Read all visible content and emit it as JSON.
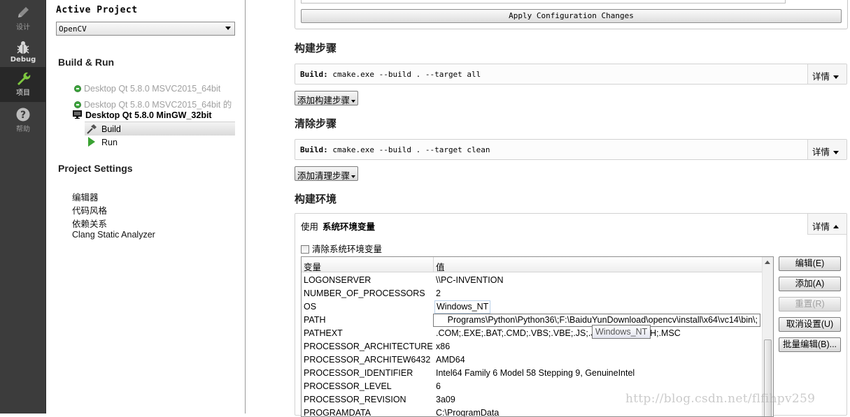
{
  "modebar": {
    "items": [
      {
        "label": "设计",
        "icon": "pencil-icon"
      },
      {
        "label": "Debug",
        "icon": "bug-icon"
      },
      {
        "label": "项目",
        "icon": "wrench-icon"
      },
      {
        "label": "帮助",
        "icon": "help-icon"
      }
    ]
  },
  "nav": {
    "active_project_title": "Active Project",
    "project_select_value": "OpenCV",
    "build_run_title": "Build & Run",
    "kits": [
      "Desktop Qt 5.8.0 MSVC2015_64bit",
      "Desktop Qt 5.8.0 MSVC2015_64bit 的",
      "Desktop Qt 5.8.0 MinGW_32bit"
    ],
    "build_label": "Build",
    "run_label": "Run",
    "project_settings_title": "Project Settings",
    "settings_items": [
      "编辑器",
      "代码风格",
      "依赖关系",
      "Clang Static Analyzer"
    ]
  },
  "main": {
    "apply_button": "Apply Configuration Changes",
    "build_steps_heading": "构建步骤",
    "build_step_prefix": "Build:",
    "build_step_command": "cmake.exe --build . --target all",
    "details_label": "详情",
    "add_build_step": "添加构建步骤",
    "clean_steps_heading": "清除步骤",
    "clean_step_prefix": "Build:",
    "clean_step_command": "cmake.exe --build . --target clean",
    "add_clean_step": "添加清理步骤",
    "build_env_heading": "构建环境",
    "env_use_label": "使用",
    "env_use_value": "系统环境变量",
    "clear_system_env": "清除系统环境变量",
    "table_headers": [
      "变量",
      "值"
    ],
    "env_rows": [
      {
        "name": "LOGONSERVER",
        "value": "\\\\PC-INVENTION"
      },
      {
        "name": "NUMBER_OF_PROCESSORS",
        "value": "2"
      },
      {
        "name": "OS",
        "value": "Windows_NT"
      },
      {
        "name": "PATH",
        "value": "Programs\\Python\\Python36\\;F:\\BaiduYunDownload\\opencv\\install\\x64\\vc14\\bin\\;"
      },
      {
        "name": "PATHEXT",
        "value": ".COM;.EXE;.BAT;.CMD;.VBS;.VBE;.JS;.JSE;.WSF;.WSH;.MSC"
      },
      {
        "name": "PROCESSOR_ARCHITECTURE",
        "value": "x86"
      },
      {
        "name": "PROCESSOR_ARCHITEW6432",
        "value": "AMD64"
      },
      {
        "name": "PROCESSOR_IDENTIFIER",
        "value": "Intel64 Family 6 Model 58 Stepping 9, GenuineIntel"
      },
      {
        "name": "PROCESSOR_LEVEL",
        "value": "6"
      },
      {
        "name": "PROCESSOR_REVISION",
        "value": "3a09"
      },
      {
        "name": "PROGRAMDATA",
        "value": "C:\\ProgramData"
      }
    ],
    "tooltip": "Windows_NT",
    "side_buttons": [
      "编辑(E)",
      "添加(A)",
      "重置(R)",
      "取消设置(U)",
      "批量编辑(B)..."
    ]
  },
  "watermark": "http://blog.csdn.net/flfihpv259"
}
